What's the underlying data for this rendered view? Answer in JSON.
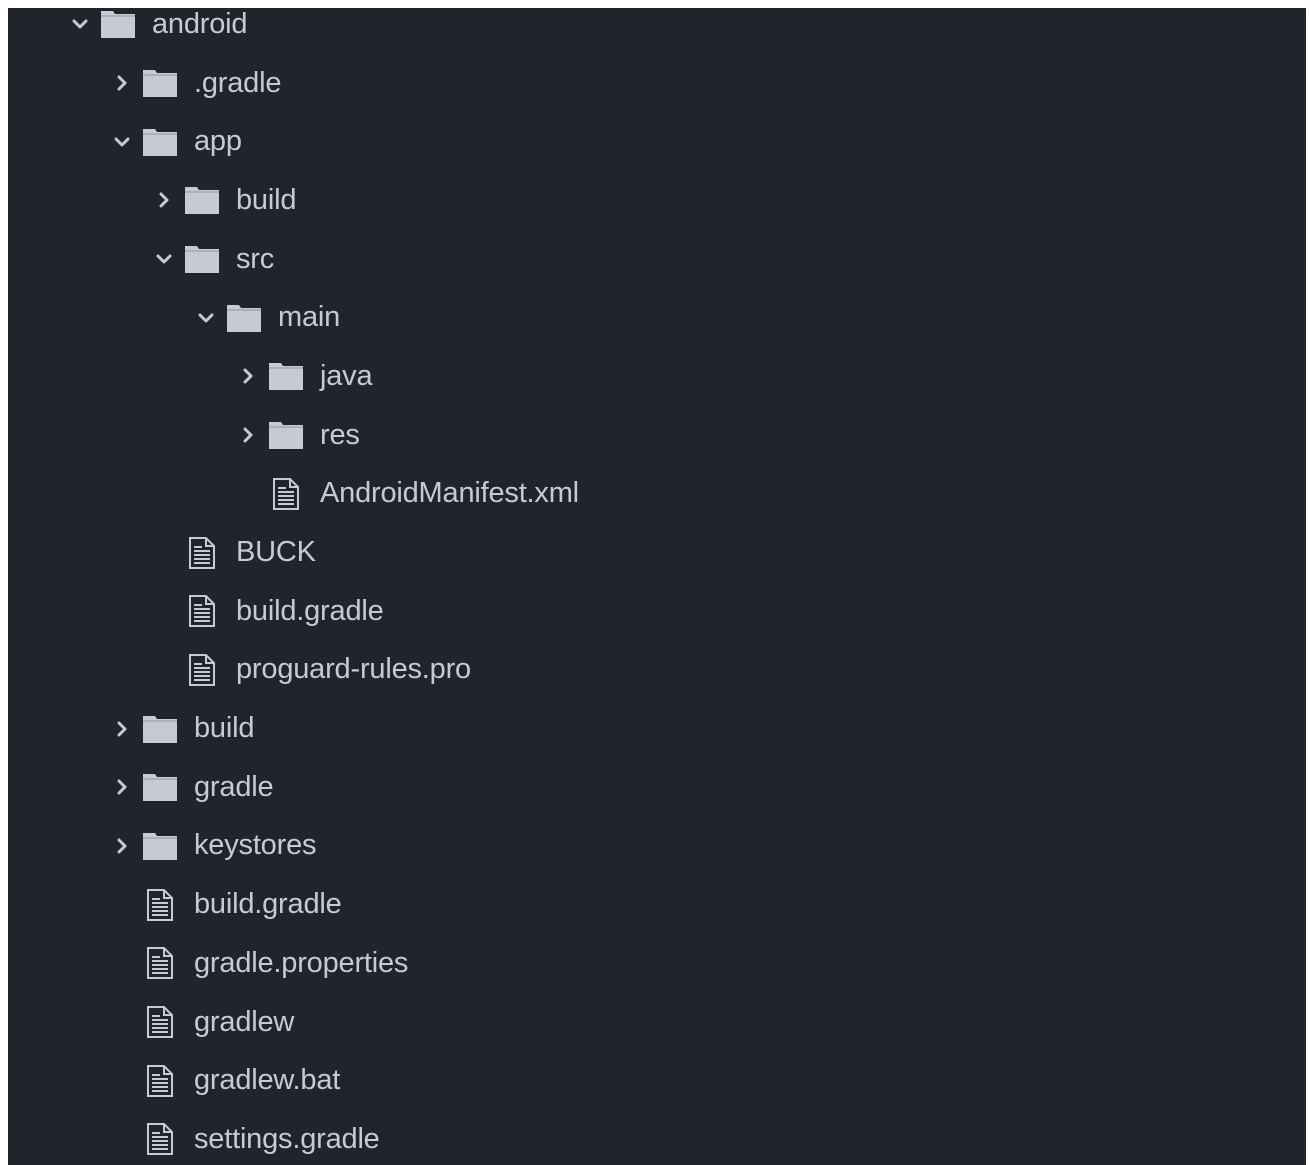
{
  "tree": {
    "nodes": [
      {
        "label": "android",
        "type": "folder",
        "state": "expanded",
        "depth": 0
      },
      {
        "label": ".gradle",
        "type": "folder",
        "state": "collapsed",
        "depth": 1
      },
      {
        "label": "app",
        "type": "folder",
        "state": "expanded",
        "depth": 1
      },
      {
        "label": "build",
        "type": "folder",
        "state": "collapsed",
        "depth": 2
      },
      {
        "label": "src",
        "type": "folder",
        "state": "expanded",
        "depth": 2
      },
      {
        "label": "main",
        "type": "folder",
        "state": "expanded",
        "depth": 3
      },
      {
        "label": "java",
        "type": "folder",
        "state": "collapsed",
        "depth": 4
      },
      {
        "label": "res",
        "type": "folder",
        "state": "collapsed",
        "depth": 4
      },
      {
        "label": "AndroidManifest.xml",
        "type": "file",
        "state": "none",
        "depth": 4
      },
      {
        "label": "BUCK",
        "type": "file",
        "state": "none",
        "depth": 2
      },
      {
        "label": "build.gradle",
        "type": "file",
        "state": "none",
        "depth": 2
      },
      {
        "label": "proguard-rules.pro",
        "type": "file",
        "state": "none",
        "depth": 2
      },
      {
        "label": "build",
        "type": "folder",
        "state": "collapsed",
        "depth": 1
      },
      {
        "label": "gradle",
        "type": "folder",
        "state": "collapsed",
        "depth": 1
      },
      {
        "label": "keystores",
        "type": "folder",
        "state": "collapsed",
        "depth": 1
      },
      {
        "label": "build.gradle",
        "type": "file",
        "state": "none",
        "depth": 1
      },
      {
        "label": "gradle.properties",
        "type": "file",
        "state": "none",
        "depth": 1
      },
      {
        "label": "gradlew",
        "type": "file",
        "state": "none",
        "depth": 1
      },
      {
        "label": "gradlew.bat",
        "type": "file",
        "state": "none",
        "depth": 1
      },
      {
        "label": "settings.gradle",
        "type": "file",
        "state": "none",
        "depth": 1
      }
    ]
  },
  "icons": {
    "folder": "folder-icon",
    "file": "file-text-icon",
    "expanded": "chevron-down-icon",
    "collapsed": "chevron-right-icon"
  },
  "colors": {
    "background": "#21252b",
    "text": "#c6cbd3",
    "icon": "#c6cbd3"
  }
}
